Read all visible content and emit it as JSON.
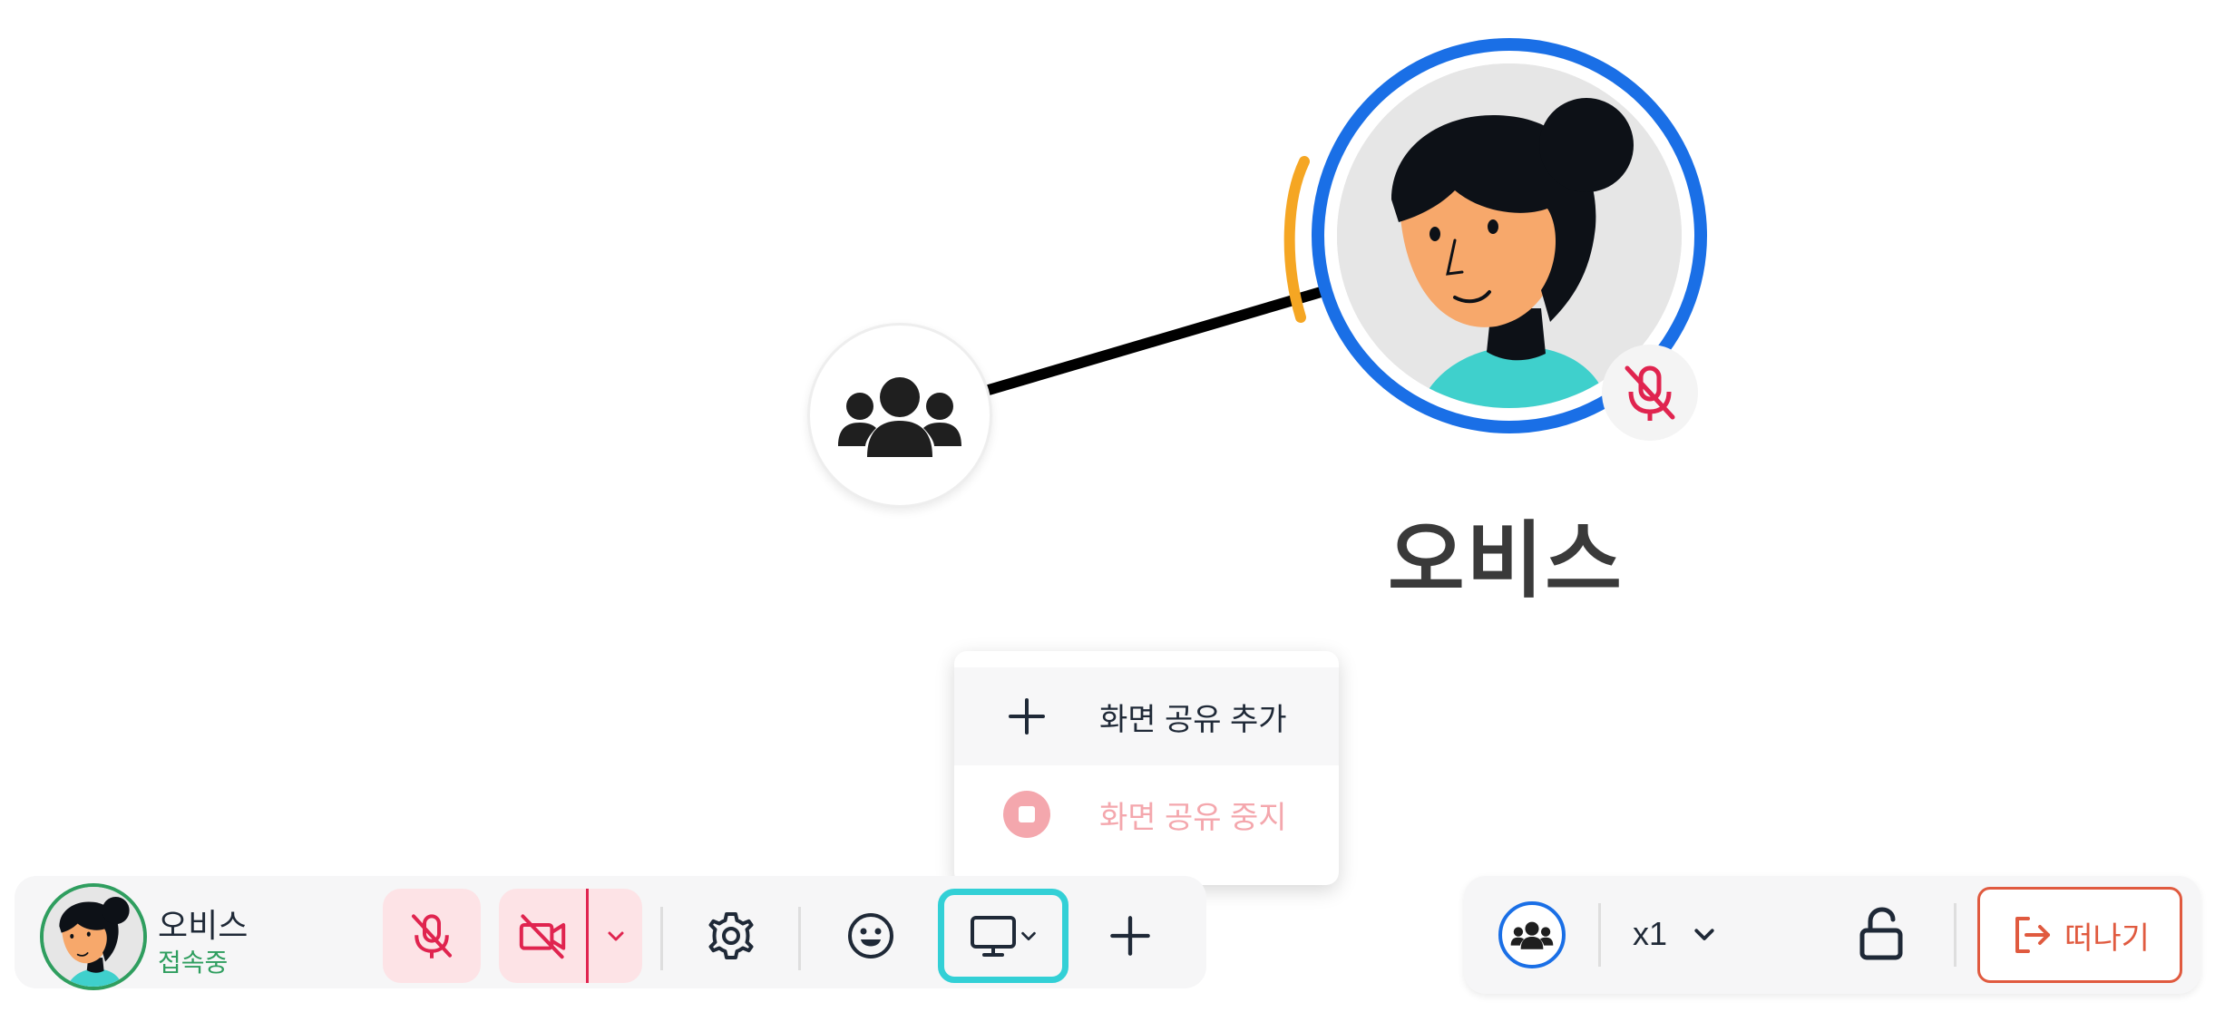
{
  "scene": {
    "participant_name": "오비스",
    "group_icon": "users-group-icon",
    "mute_icon": "mic-off-icon"
  },
  "share_menu": {
    "add_label": "화면 공유 추가",
    "stop_label": "화면 공유 중지",
    "add_icon": "plus-icon",
    "stop_icon": "stop-circle-icon"
  },
  "toolbar": {
    "user_name": "오비스",
    "user_status": "접속중",
    "buttons": [
      "mic-off-icon",
      "camera-off-icon",
      "chevron-down-icon",
      "gear-icon",
      "emoji-icon",
      "monitor-icon",
      "plus-icon"
    ]
  },
  "right_bar": {
    "speed_label": "x1",
    "leave_label": "떠나기",
    "icons": [
      "users-group-icon",
      "chevron-down-icon",
      "unlock-icon",
      "logout-icon"
    ]
  },
  "colors": {
    "accent_blue": "#1a6fe6",
    "online_green": "#2f9e5f",
    "mute_red": "#e0244f",
    "pink_bg": "#fde3e6",
    "highlight_cyan": "#33d0d6",
    "leave_orange": "#e05a3f",
    "speaking_orange": "#f5a623"
  }
}
